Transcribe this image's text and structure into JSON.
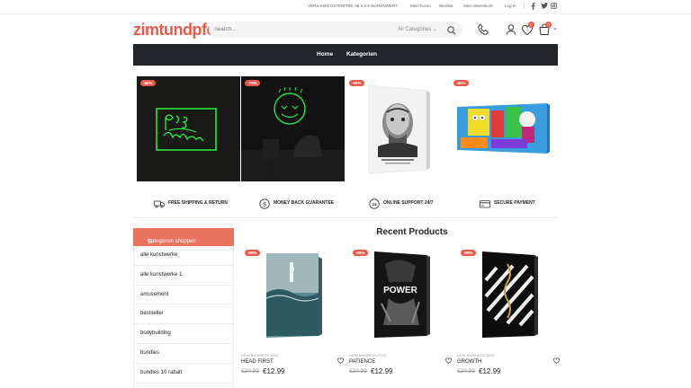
{
  "topbar": {
    "notice": "VERSANDKOSTENFREI AB 5,9 € WARENWERT",
    "links": [
      "Mein Konto",
      "Wishlist",
      "Mein Warenkorb",
      "Log In"
    ],
    "social": [
      "facebook-icon",
      "twitter-icon",
      "instagram-icon"
    ]
  },
  "header": {
    "logo": "zimtundpfef",
    "search_placeholder": "Search...",
    "category_select": "All Categories",
    "wishlist_count": "0",
    "cart_count": "0"
  },
  "nav": {
    "items": [
      "Home",
      "Kategorien"
    ]
  },
  "banners": [
    {
      "sale": "-60%"
    },
    {
      "sale": "-70%"
    },
    {
      "sale": "-58%"
    },
    {
      "sale": "-60%"
    }
  ],
  "features": [
    {
      "icon": "truck-icon",
      "label": "FREE SHIPPING & RETURN"
    },
    {
      "icon": "dollar-icon",
      "label": "MONEY BACK GUARANTEE"
    },
    {
      "icon": "support-24-icon",
      "label": "ONLINE SUPPORT 24/7"
    },
    {
      "icon": "credit-card-icon",
      "label": "SECURE PAYMENT"
    }
  ],
  "sidebar": {
    "title": "Kategorien shoppen",
    "items": [
      "alle kunstwerke",
      "alle kunstwerke 1",
      "amusement",
      "bestseller",
      "bodybuilding",
      "bundles",
      "bundles 10 rabatt"
    ]
  },
  "products": {
    "title": "Recent Products",
    "items": [
      {
        "sale": "-58%",
        "category": "DEIN BUSINESS 2023",
        "name": "HEAD FIRST",
        "old_price": "€29.99",
        "price": "€12.99"
      },
      {
        "sale": "-58%",
        "category": "DEIN BUSINESS 2023",
        "name": "PATIENCE",
        "old_price": "€29.99",
        "price": "€12.99"
      },
      {
        "sale": "-58%",
        "category": "DEIN BUSINESS 2023",
        "name": "GROWTH",
        "old_price": "€29.99",
        "price": "€12.99"
      }
    ]
  },
  "colors": {
    "accent": "#e8594a",
    "nav_bg": "#222529",
    "sidebar_head": "#e8735f"
  }
}
